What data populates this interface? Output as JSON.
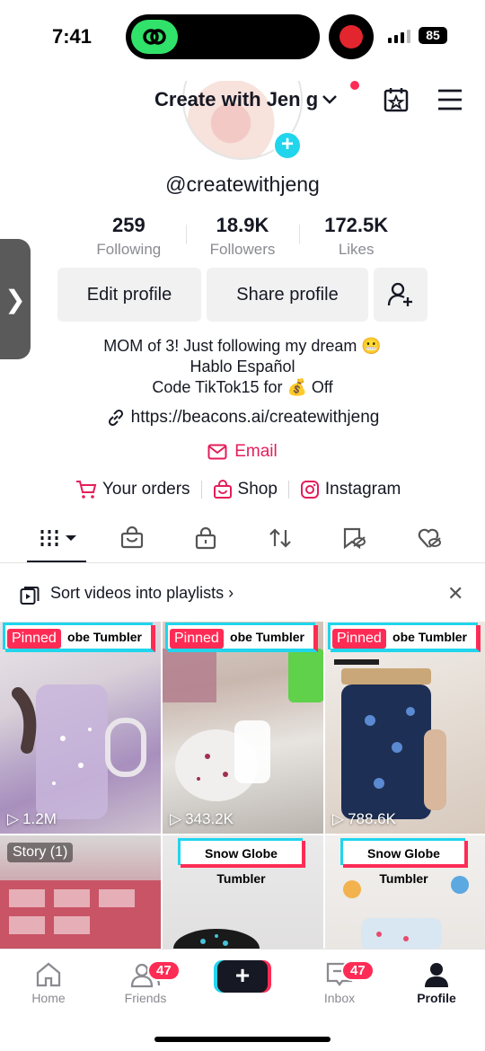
{
  "status_bar": {
    "time": "7:41",
    "battery": "85"
  },
  "header": {
    "title": "Create with Jen g"
  },
  "profile": {
    "handle": "@createwithjeng",
    "stats": [
      {
        "value": "259",
        "label": "Following"
      },
      {
        "value": "18.9K",
        "label": "Followers"
      },
      {
        "value": "172.5K",
        "label": "Likes"
      }
    ],
    "buttons": {
      "edit": "Edit profile",
      "share": "Share profile"
    },
    "bio": [
      "MOM of 3! Just following my dream 😬",
      "Hablo Español",
      "Code TikTok15 for 💰 Off"
    ],
    "link": "https://beacons.ai/createwithjeng",
    "email": "Email",
    "shop_links": [
      "Your orders",
      "Shop",
      "Instagram"
    ]
  },
  "sort_bar": {
    "label": "Sort videos into playlists"
  },
  "videos": [
    {
      "pinned": "Pinned",
      "title": "obe Tumbler",
      "views": "1.2M"
    },
    {
      "pinned": "Pinned",
      "title": "obe Tumbler",
      "views": "343.2K"
    },
    {
      "pinned": "Pinned",
      "title": "obe Tumbler",
      "views": "788.6K"
    },
    {
      "story": "Story (1)"
    },
    {
      "title": "Snow Globe Tumbler"
    },
    {
      "title": "Snow Globe Tumbler"
    }
  ],
  "bottom_nav": {
    "items": [
      "Home",
      "Friends",
      "Inbox",
      "Profile"
    ],
    "friends_badge": "47",
    "inbox_badge": "47"
  },
  "colors": {
    "accent_pink": "#fe2c55",
    "accent_cyan": "#20d5ec",
    "email_pink": "#e41e5a"
  }
}
